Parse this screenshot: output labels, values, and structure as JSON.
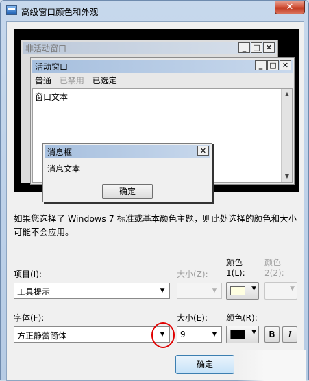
{
  "window": {
    "title": "高级窗口颜色和外观",
    "close_glyph": "✕"
  },
  "preview": {
    "inactive_title": "非活动窗口",
    "active_title": "活动窗口",
    "caption_minimize": "_",
    "caption_maximize": "□",
    "caption_close": "✕",
    "menu_normal": "普通",
    "menu_disabled": "已禁用",
    "menu_selected": "已选定",
    "window_text": "窗口文本",
    "msgbox_title": "消息框",
    "msgbox_text": "消息文本",
    "msgbox_ok": "确定"
  },
  "info_text": "如果您选择了 Windows 7 标准或基本颜色主题，则此处选择的颜色和大小可能不会应用。",
  "item": {
    "label": "项目(I):",
    "value": "工具提示",
    "size_label": "大小(Z):",
    "color1_label_line1": "颜色",
    "color1_label_line2": "1(L):",
    "color2_label_line1": "颜色",
    "color2_label_line2": "2(2):",
    "color1_value": "#ffffe1"
  },
  "font": {
    "label": "字体(F):",
    "value": "方正静蕾简体",
    "size_label": "大小(E):",
    "size_value": "9",
    "color_label": "颜色(R):",
    "color_value": "#000000",
    "bold_label": "B",
    "italic_label": "I"
  },
  "ok_label": "确定",
  "dropdown_glyph": "▼",
  "scroll_up": "▲",
  "scroll_down": "▼"
}
